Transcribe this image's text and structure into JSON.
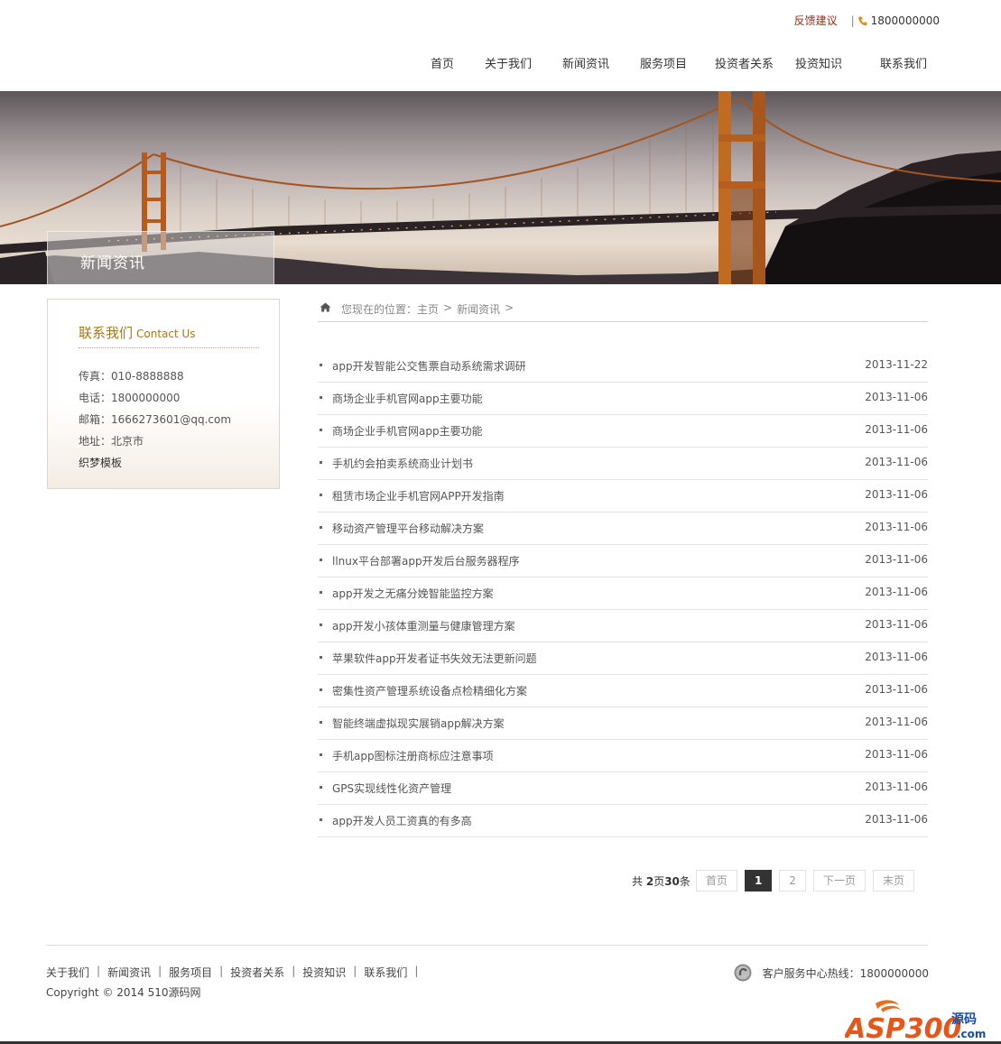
{
  "header": {
    "feedback_label": "反馈建议",
    "separator": "|",
    "phone": "1800000000",
    "nav": [
      {
        "label": "首页"
      },
      {
        "label": "关于我们"
      },
      {
        "label": "新闻资讯"
      },
      {
        "label": "服务项目"
      },
      {
        "label": "投资者关系"
      },
      {
        "label": "投资知识"
      },
      {
        "label": "联系我们"
      }
    ]
  },
  "banner": {
    "label": "新闻资讯"
  },
  "sidebar": {
    "title_cn": "联系我们",
    "title_en": "Contact Us",
    "fax": "传真：010-8888888",
    "tel": "电话：1800000000",
    "email": "邮箱：1666273601@qq.com",
    "address": "地址：北京市",
    "extra": "织梦模板"
  },
  "breadcrumb": {
    "prefix": "您现在的位置：",
    "home": "主页",
    "gt": ">",
    "current": "新闻资讯"
  },
  "news": [
    {
      "title": "app开发智能公交售票自动系统需求调研",
      "date": "2013-11-22"
    },
    {
      "title": "商场企业手机官网app主要功能",
      "date": "2013-11-06"
    },
    {
      "title": "商场企业手机官网app主要功能",
      "date": "2013-11-06"
    },
    {
      "title": "手机约会拍卖系统商业计划书",
      "date": "2013-11-06"
    },
    {
      "title": "租赁市场企业手机官网APP开发指南",
      "date": "2013-11-06"
    },
    {
      "title": "移动资产管理平台移动解决方案",
      "date": "2013-11-06"
    },
    {
      "title": "llnux平台部署app开发后台服务器程序",
      "date": "2013-11-06"
    },
    {
      "title": "app开发之无痛分娩智能监控方案",
      "date": "2013-11-06"
    },
    {
      "title": "app开发小孩体重测量与健康管理方案",
      "date": "2013-11-06"
    },
    {
      "title": "苹果软件app开发者证书失效无法更新问题",
      "date": "2013-11-06"
    },
    {
      "title": "密集性资产管理系统设备点检精细化方案",
      "date": "2013-11-06"
    },
    {
      "title": "智能终端虚拟现实展销app解决方案",
      "date": "2013-11-06"
    },
    {
      "title": "手机app图标注册商标应注意事项",
      "date": "2013-11-06"
    },
    {
      "title": "GPS实现线性化资产管理",
      "date": "2013-11-06"
    },
    {
      "title": "app开发人员工资真的有多高",
      "date": "2013-11-06"
    }
  ],
  "pagination": {
    "info_prefix": "共 ",
    "pages": "2",
    "info_mid": "页",
    "total": "30",
    "info_suffix": "条",
    "first": "首页",
    "page1": "1",
    "page2": "2",
    "next": "下一页",
    "last": "末页"
  },
  "footer": {
    "links": [
      {
        "label": "关于我们"
      },
      {
        "label": "新闻资讯"
      },
      {
        "label": "服务项目"
      },
      {
        "label": "投资者关系"
      },
      {
        "label": "投资知识"
      },
      {
        "label": "联系我们"
      }
    ],
    "link_sep": "|",
    "copyright": "Copyright © 2014 510源码网",
    "hotline": "客户服务中心热线：1800000000"
  },
  "watermark": {
    "brand": "ASP300",
    "suffix": "源码",
    "domain": ".com"
  }
}
